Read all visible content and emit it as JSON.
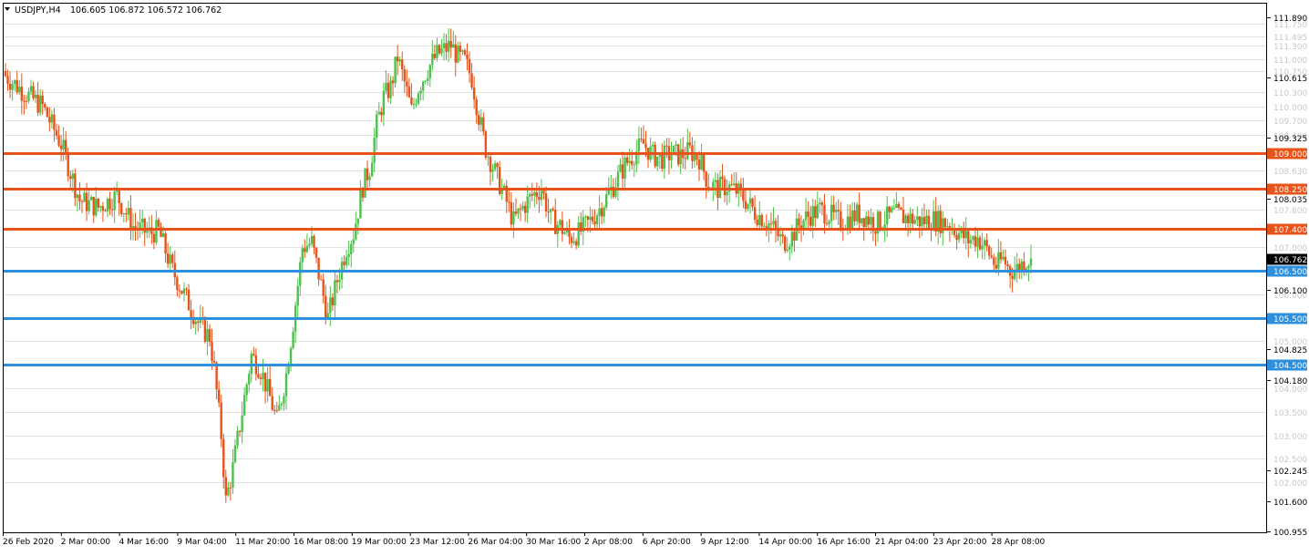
{
  "header": {
    "symbol": "USDJPY,H4",
    "ohlc": "106.605 106.872 106.572 106.762",
    "dropdown_icon": "triangle-down-icon"
  },
  "chart_data": {
    "type": "candlestick",
    "symbol": "USDJPY",
    "timeframe": "H4",
    "ylim": [
      100.955,
      112.03
    ],
    "grid": true,
    "colors": {
      "bull": "#4cc24c",
      "bear": "#e8531a",
      "resistance": "#e8531a",
      "support": "#2e8fdc",
      "grid": "#e2e2e2",
      "faded_label": "#c8c8c8"
    },
    "price_ticks": [
      "111.890",
      "110.615",
      "109.325",
      "108.035",
      "106.100",
      "104.825",
      "104.180",
      "102.245",
      "101.600",
      "100.955"
    ],
    "faded_levels": [
      "111.750",
      "111.495",
      "111.300",
      "111.000",
      "110.750",
      "110.300",
      "110.000",
      "109.700",
      "109.400",
      "108.630",
      "107.800",
      "107.000",
      "106.000",
      "105.000",
      "104.000",
      "103.500",
      "103.000",
      "102.500",
      "102.000"
    ],
    "horizontal_levels": [
      {
        "price": 109.0,
        "label": "109.000",
        "role": "resistance"
      },
      {
        "price": 108.25,
        "label": "108.250",
        "role": "resistance"
      },
      {
        "price": 107.4,
        "label": "107.400",
        "role": "resistance"
      },
      {
        "price": 106.5,
        "label": "106.500",
        "role": "support"
      },
      {
        "price": 105.5,
        "label": "105.500",
        "role": "support"
      },
      {
        "price": 104.5,
        "label": "104.500",
        "role": "support"
      }
    ],
    "current_price": "106.762",
    "x_labels": [
      "26 Feb 2020",
      "2 Mar 00:00",
      "4 Mar 16:00",
      "9 Mar 04:00",
      "11 Mar 20:00",
      "16 Mar 08:00",
      "19 Mar 00:00",
      "23 Mar 12:00",
      "26 Mar 04:00",
      "30 Mar 16:00",
      "2 Apr 08:00",
      "6 Apr 20:00",
      "9 Apr 12:00",
      "14 Apr 00:00",
      "16 Apr 16:00",
      "21 Apr 04:00",
      "23 Apr 20:00",
      "28 Apr 08:00"
    ],
    "close_path": [
      [
        0,
        110.65
      ],
      [
        8,
        110.3
      ],
      [
        16,
        110.0
      ],
      [
        24,
        109.2
      ],
      [
        32,
        108.0
      ],
      [
        40,
        107.85
      ],
      [
        48,
        108.1
      ],
      [
        55,
        107.45
      ],
      [
        62,
        107.3
      ],
      [
        66,
        107.35
      ],
      [
        72,
        106.5
      ],
      [
        78,
        105.9
      ],
      [
        84,
        105.3
      ],
      [
        88,
        105.1
      ],
      [
        90,
        104.4
      ],
      [
        93,
        103.0
      ],
      [
        95,
        101.6
      ],
      [
        98,
        102.3
      ],
      [
        102,
        103.5
      ],
      [
        106,
        104.7
      ],
      [
        110,
        104.4
      ],
      [
        114,
        103.8
      ],
      [
        117,
        103.3
      ],
      [
        121,
        104.3
      ],
      [
        124,
        105.4
      ],
      [
        128,
        107.0
      ],
      [
        132,
        107.1
      ],
      [
        136,
        106.2
      ],
      [
        139,
        105.5
      ],
      [
        143,
        106.3
      ],
      [
        147,
        107.0
      ],
      [
        150,
        107.3
      ],
      [
        154,
        108.3
      ],
      [
        157,
        108.7
      ],
      [
        160,
        109.6
      ],
      [
        163,
        110.2
      ],
      [
        166,
        110.4
      ],
      [
        169,
        111.05
      ],
      [
        172,
        110.5
      ],
      [
        175,
        109.9
      ],
      [
        178,
        110.4
      ],
      [
        182,
        110.8
      ],
      [
        186,
        111.1
      ],
      [
        189,
        111.2
      ],
      [
        192,
        111.3
      ],
      [
        195,
        111.05
      ],
      [
        198,
        110.95
      ],
      [
        201,
        110.6
      ],
      [
        204,
        109.8
      ],
      [
        207,
        109.1
      ],
      [
        211,
        108.6
      ],
      [
        215,
        108.1
      ],
      [
        219,
        107.55
      ],
      [
        223,
        107.85
      ],
      [
        227,
        108.1
      ],
      [
        231,
        108.25
      ],
      [
        235,
        107.6
      ],
      [
        239,
        107.45
      ],
      [
        243,
        107.2
      ],
      [
        247,
        107.3
      ],
      [
        251,
        107.5
      ],
      [
        255,
        107.75
      ],
      [
        259,
        108.05
      ],
      [
        263,
        108.4
      ],
      [
        267,
        108.75
      ],
      [
        271,
        109.0
      ],
      [
        275,
        109.2
      ],
      [
        279,
        108.95
      ],
      [
        283,
        108.9
      ],
      [
        287,
        109.0
      ],
      [
        291,
        108.95
      ],
      [
        295,
        109.05
      ],
      [
        299,
        108.9
      ],
      [
        303,
        108.35
      ],
      [
        307,
        108.25
      ],
      [
        311,
        108.3
      ],
      [
        315,
        108.2
      ],
      [
        319,
        108.0
      ],
      [
        323,
        107.75
      ],
      [
        327,
        107.6
      ],
      [
        331,
        107.4
      ],
      [
        335,
        107.1
      ],
      [
        339,
        107.25
      ],
      [
        343,
        107.55
      ],
      [
        347,
        107.7
      ],
      [
        351,
        107.8
      ],
      [
        355,
        107.7
      ],
      [
        359,
        107.55
      ],
      [
        363,
        107.6
      ],
      [
        367,
        107.7
      ],
      [
        371,
        107.65
      ],
      [
        375,
        107.5
      ],
      [
        379,
        107.6
      ],
      [
        383,
        107.7
      ],
      [
        387,
        107.65
      ],
      [
        391,
        107.6
      ],
      [
        395,
        107.55
      ],
      [
        399,
        107.6
      ],
      [
        403,
        107.55
      ],
      [
        407,
        107.5
      ],
      [
        411,
        107.3
      ],
      [
        415,
        107.15
      ],
      [
        419,
        107.2
      ],
      [
        423,
        106.95
      ],
      [
        427,
        106.6
      ],
      [
        430,
        106.75
      ],
      [
        433,
        106.5
      ],
      [
        436,
        106.55
      ],
      [
        439,
        106.7
      ],
      [
        442,
        106.762
      ]
    ]
  }
}
